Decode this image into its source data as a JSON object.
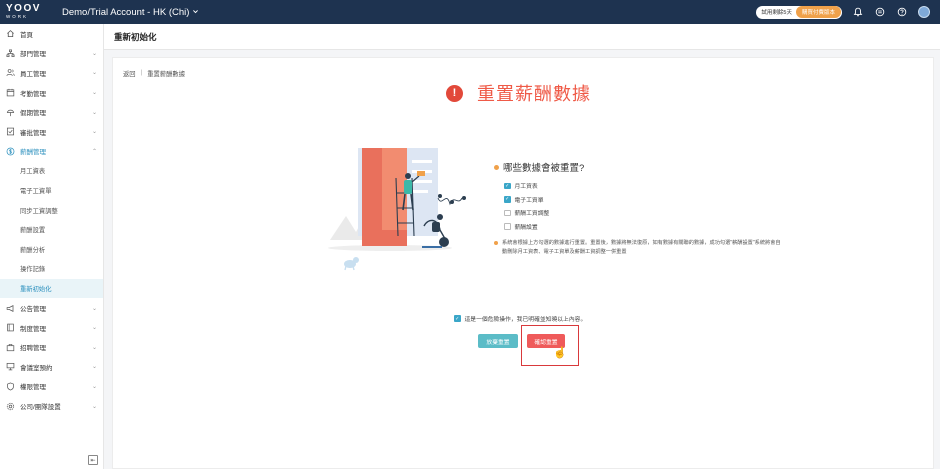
{
  "topbar": {
    "logo_main": "YOOV",
    "logo_sub": "WORK",
    "account": "Demo/Trial Account - HK (Chi)",
    "trial_days": "試用剩餘5天",
    "buy_label": "購買付費版本"
  },
  "sidebar": {
    "items": [
      {
        "label": "首頁",
        "icon": "home-icon",
        "expandable": false
      },
      {
        "label": "部門管理",
        "icon": "org-chart-icon",
        "expandable": true
      },
      {
        "label": "員工管理",
        "icon": "users-icon",
        "expandable": true
      },
      {
        "label": "考勤管理",
        "icon": "calendar-icon",
        "expandable": true
      },
      {
        "label": "假期管理",
        "icon": "leave-icon",
        "expandable": true
      },
      {
        "label": "審批管理",
        "icon": "approval-icon",
        "expandable": true
      },
      {
        "label": "薪酬管理",
        "icon": "dollar-icon",
        "expandable": true,
        "open": true
      },
      {
        "label": "公告管理",
        "icon": "megaphone-icon",
        "expandable": true
      },
      {
        "label": "制度管理",
        "icon": "book-icon",
        "expandable": true
      },
      {
        "label": "招聘管理",
        "icon": "recruit-icon",
        "expandable": true
      },
      {
        "label": "會議室預約",
        "icon": "meeting-icon",
        "expandable": true
      },
      {
        "label": "權限管理",
        "icon": "shield-icon",
        "expandable": true
      },
      {
        "label": "公司/團隊設置",
        "icon": "settings-icon",
        "expandable": true
      }
    ],
    "payroll_sub": [
      "月工資表",
      "電子工資單",
      "同步工資調整",
      "薪酬設置",
      "薪酬分析",
      "操作記錄",
      "重新初始化"
    ],
    "active_sub": "重新初始化"
  },
  "page": {
    "title": "重新初始化",
    "breadcrumb_back": "返回",
    "breadcrumb_sep": "|",
    "breadcrumb_current": "重置薪酬數據",
    "headline": "重置薪酬數據"
  },
  "reset": {
    "question": "哪些數據會被重置?",
    "options": [
      {
        "label": "月工資表",
        "checked": true
      },
      {
        "label": "電子工資單",
        "checked": true
      },
      {
        "label": "薪酬工資調整",
        "checked": false
      },
      {
        "label": "薪酬設置",
        "checked": false
      }
    ],
    "note": "系統會根據上方勾選的數據進行重置。重置後，數據將無法復原，如有數據有關聯的數據，成功勾選\"薪酬設置\"系統將會自動刪除月工資表、電子工資單及薪酬工資調整一併重置"
  },
  "confirm": {
    "text": "這是一個危險操作，我已明確並知曉以上內容。",
    "checked": true,
    "cancel_label": "放棄重置",
    "confirm_label": "確認重置"
  },
  "colors": {
    "topbar": "#1e3350",
    "accent": "#2a8fbd",
    "danger": "#ef5a47",
    "highlight_box": "#d9393b"
  }
}
